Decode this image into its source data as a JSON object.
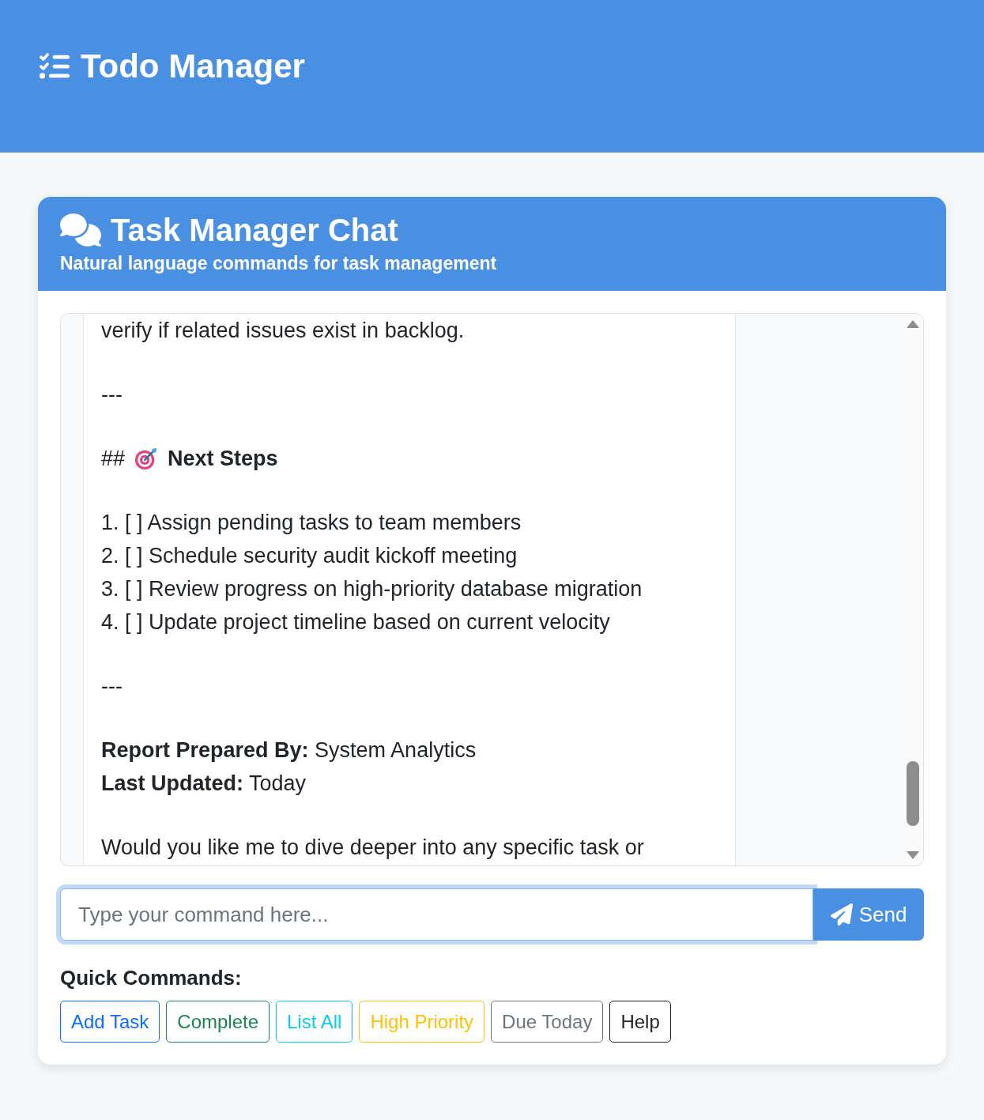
{
  "header": {
    "title": "Todo Manager"
  },
  "chat": {
    "title": "Task Manager Chat",
    "subtitle": "Natural language commands for task management",
    "message": {
      "blocks": [
        {
          "kind": "text",
          "lines": [
            "verify if related issues exist in backlog."
          ]
        },
        {
          "kind": "rule",
          "lines": [
            "---"
          ]
        },
        {
          "kind": "heading",
          "marker": "##",
          "text": "Next Steps"
        },
        {
          "kind": "list",
          "lines": [
            "1. [ ] Assign pending tasks to team members",
            "2. [ ] Schedule security audit kickoff meeting",
            "3. [ ] Review progress on high-priority database migration",
            "4. [ ] Update project timeline based on current velocity"
          ]
        },
        {
          "kind": "rule",
          "lines": [
            "---"
          ]
        },
        {
          "kind": "meta",
          "lines": [
            "**Report Prepared By:** System Analytics",
            "**Last Updated:** Today"
          ]
        },
        {
          "kind": "text",
          "lines": [
            "Would you like me to dive deeper into any specific task or"
          ]
        }
      ]
    },
    "input": {
      "placeholder": "Type your command here...",
      "focused": true
    },
    "send_button": {
      "label": "Send"
    }
  },
  "quick_commands": {
    "label": "Quick Commands:",
    "buttons": [
      {
        "label": "Add Task",
        "color": "#0d6efd"
      },
      {
        "label": "Complete",
        "color": "#198754"
      },
      {
        "label": "List All",
        "color": "#0dcaf0"
      },
      {
        "label": "High Priority",
        "color": "#ffc107"
      },
      {
        "label": "Due Today",
        "color": "#6c757d"
      },
      {
        "label": "Help",
        "color": "#212529"
      }
    ]
  }
}
